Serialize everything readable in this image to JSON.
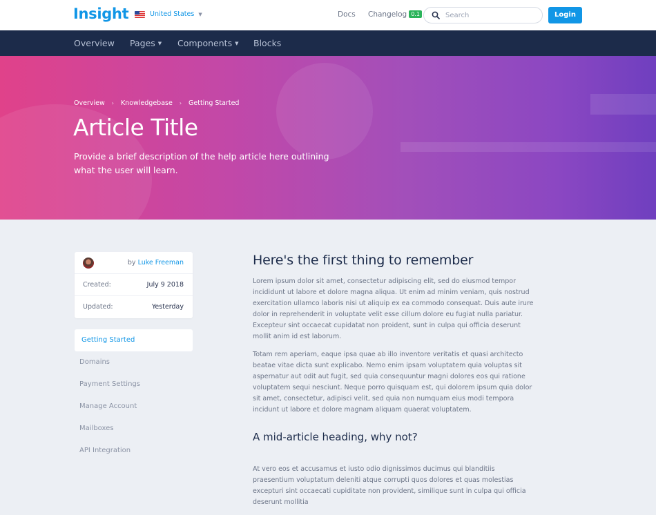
{
  "header": {
    "brand": "Insight",
    "locale": "United States",
    "links": {
      "docs": "Docs",
      "changelog": "Changelog",
      "changelog_badge": "0.1"
    },
    "search_placeholder": "Search",
    "login": "Login"
  },
  "nav": {
    "overview": "Overview",
    "pages": "Pages",
    "components": "Components",
    "blocks": "Blocks"
  },
  "hero": {
    "breadcrumbs": [
      "Overview",
      "Knowledgebase",
      "Getting Started"
    ],
    "title": "Article Title",
    "description": "Provide a brief description of the help article here outlining what the user will learn."
  },
  "meta": {
    "by_prefix": "by",
    "author": "Luke Freeman",
    "created_label": "Created:",
    "created_value": "July 9 2018",
    "updated_label": "Updated:",
    "updated_value": "Yesterday"
  },
  "sidebar": {
    "items": [
      {
        "label": "Getting Started"
      },
      {
        "label": "Domains"
      },
      {
        "label": "Payment Settings"
      },
      {
        "label": "Manage Account"
      },
      {
        "label": "Mailboxes"
      },
      {
        "label": "API Integration"
      }
    ]
  },
  "article": {
    "heading": "Here's the first thing to remember",
    "p1": "Lorem ipsum dolor sit amet, consectetur adipiscing elit, sed do eiusmod tempor incididunt ut labore et dolore magna aliqua. Ut enim ad minim veniam, quis nostrud exercitation ullamco laboris nisi ut aliquip ex ea commodo consequat. Duis aute irure dolor in reprehenderit in voluptate velit esse cillum dolore eu fugiat nulla pariatur. Excepteur sint occaecat cupidatat non proident, sunt in culpa qui officia deserunt mollit anim id est laborum.",
    "p2": "Totam rem aperiam, eaque ipsa quae ab illo inventore veritatis et quasi architecto beatae vitae dicta sunt explicabo. Nemo enim ipsam voluptatem quia voluptas sit aspernatur aut odit aut fugit, sed quia consequuntur magni dolores eos qui ratione voluptatem sequi nesciunt. Neque porro quisquam est, qui dolorem ipsum quia dolor sit amet, consectetur, adipisci velit, sed quia non numquam eius modi tempora incidunt ut labore et dolore magnam aliquam quaerat voluptatem.",
    "subheading": "A mid-article heading, why not?",
    "p3": "At vero eos et accusamus et iusto odio dignissimos ducimus qui blanditiis praesentium voluptatum deleniti atque corrupti quos dolores et quas molestias excepturi sint occaecati cupiditate non provident, similique sunt in culpa qui officia deserunt mollitia"
  },
  "colors": {
    "brand": "#1196e6",
    "nav_bg": "#1c2b4a",
    "page_bg": "#eceff4",
    "hero_gradient_start": "#e0428a",
    "hero_gradient_end": "#6f3fbf",
    "badge": "#2bb45a"
  },
  "icons": {
    "flag": "us-flag-icon",
    "search": "search-icon",
    "caret": "caret-down-icon",
    "separator": "chevron-right-icon"
  }
}
